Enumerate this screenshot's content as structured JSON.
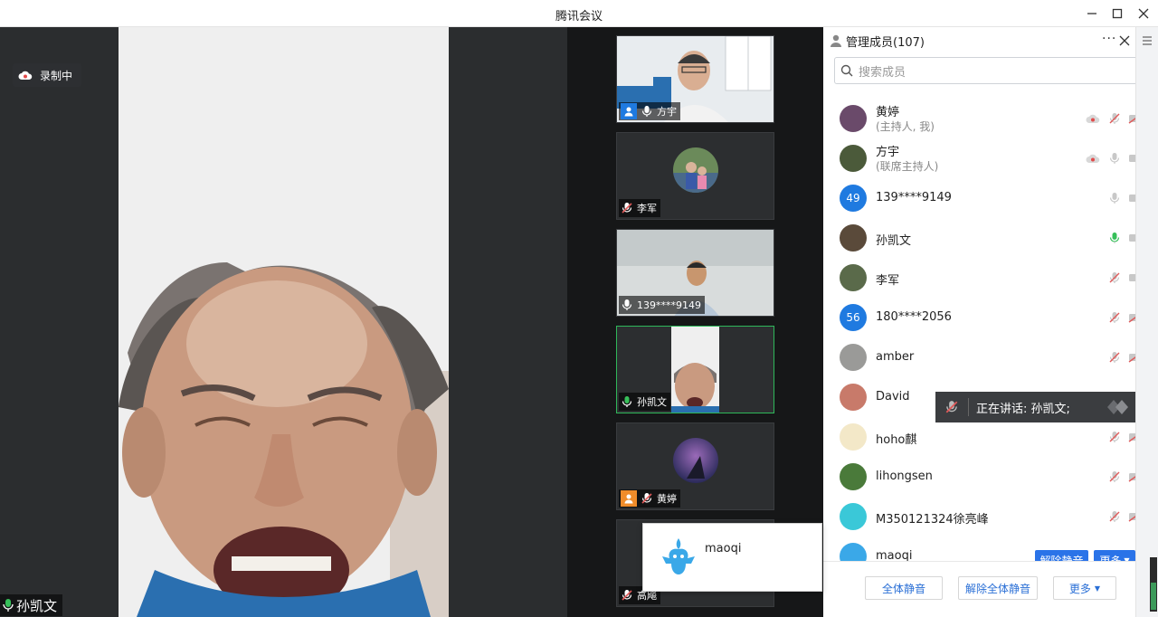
{
  "window": {
    "title": "腾讯会议"
  },
  "main_video": {
    "recording_label": "录制中",
    "speaker_name": "孙凯文"
  },
  "video_tiles": [
    {
      "name": "方宇",
      "mic": "on",
      "has_user_badge": true,
      "badge_color": "#1f7ae0",
      "type": "camera"
    },
    {
      "name": "李军",
      "mic": "muted",
      "has_user_badge": false,
      "type": "avatar"
    },
    {
      "name": "139****9149",
      "mic": "on",
      "has_user_badge": false,
      "type": "camera"
    },
    {
      "name": "孙凯文",
      "mic": "speaking",
      "has_user_badge": false,
      "type": "camera",
      "active": true
    },
    {
      "name": "黄婷",
      "mic": "muted",
      "has_user_badge": true,
      "badge_color": "#f08c2a",
      "type": "avatar"
    },
    {
      "name": "高飚",
      "mic": "muted",
      "has_user_badge": false,
      "type": "avatar"
    }
  ],
  "panel": {
    "title": "管理成员(107)",
    "search_placeholder": "搜索成员",
    "members": [
      {
        "name": "黄婷",
        "role": "(主持人, 我)",
        "avatar_text": "",
        "avatar_color": "#6a4a6a",
        "mic": "muted",
        "video": "off",
        "recording": true
      },
      {
        "name": "方宇",
        "role": "(联席主持人)",
        "avatar_text": "",
        "avatar_color": "#4b5a3a",
        "mic": "idle",
        "video": "idle",
        "recording": true
      },
      {
        "name": "139****9149",
        "role": "",
        "avatar_text": "49",
        "avatar_color": "#1f7ae0",
        "mic": "idle",
        "video": "idle"
      },
      {
        "name": "孙凯文",
        "role": "",
        "avatar_text": "",
        "avatar_color": "#5a4a3a",
        "mic": "speaking",
        "video": "idle"
      },
      {
        "name": "李军",
        "role": "",
        "avatar_text": "",
        "avatar_color": "#5a6a4a",
        "mic": "muted",
        "video": "idle"
      },
      {
        "name": "180****2056",
        "role": "",
        "avatar_text": "56",
        "avatar_color": "#1f7ae0",
        "mic": "muted",
        "video": "off"
      },
      {
        "name": "amber",
        "role": "",
        "avatar_text": "",
        "avatar_color": "#9a9a98",
        "mic": "muted",
        "video": "off"
      },
      {
        "name": "David",
        "role": "",
        "avatar_text": "",
        "avatar_color": "#c87a6a",
        "mic": "idle",
        "video": "idle"
      },
      {
        "name": "hoho麒",
        "role": "",
        "avatar_text": "",
        "avatar_color": "#f3e8c8",
        "mic": "muted",
        "video": "off"
      },
      {
        "name": "lihongsen",
        "role": "",
        "avatar_text": "",
        "avatar_color": "#4a7a3a",
        "mic": "muted",
        "video": "off"
      },
      {
        "name": "M350121324徐亮峰",
        "role": "",
        "avatar_text": "",
        "avatar_color": "#3ac8d8",
        "mic": "muted",
        "video": "off"
      },
      {
        "name": "maoqi",
        "role": "",
        "avatar_text": "",
        "avatar_color": "#3aa8e8",
        "mic": "",
        "video": ""
      }
    ],
    "row_buttons": {
      "unmute": "解除静音",
      "more": "更多"
    },
    "speaking_banner": "正在讲话: 孙凯文;",
    "footer": {
      "mute_all": "全体静音",
      "unmute_all": "解除全体静音",
      "more": "更多"
    }
  },
  "popup": {
    "name": "maoqi"
  },
  "colors": {
    "accent": "#2a73e8",
    "active_border": "#2fb85a",
    "muted_red": "#e05a5a"
  }
}
